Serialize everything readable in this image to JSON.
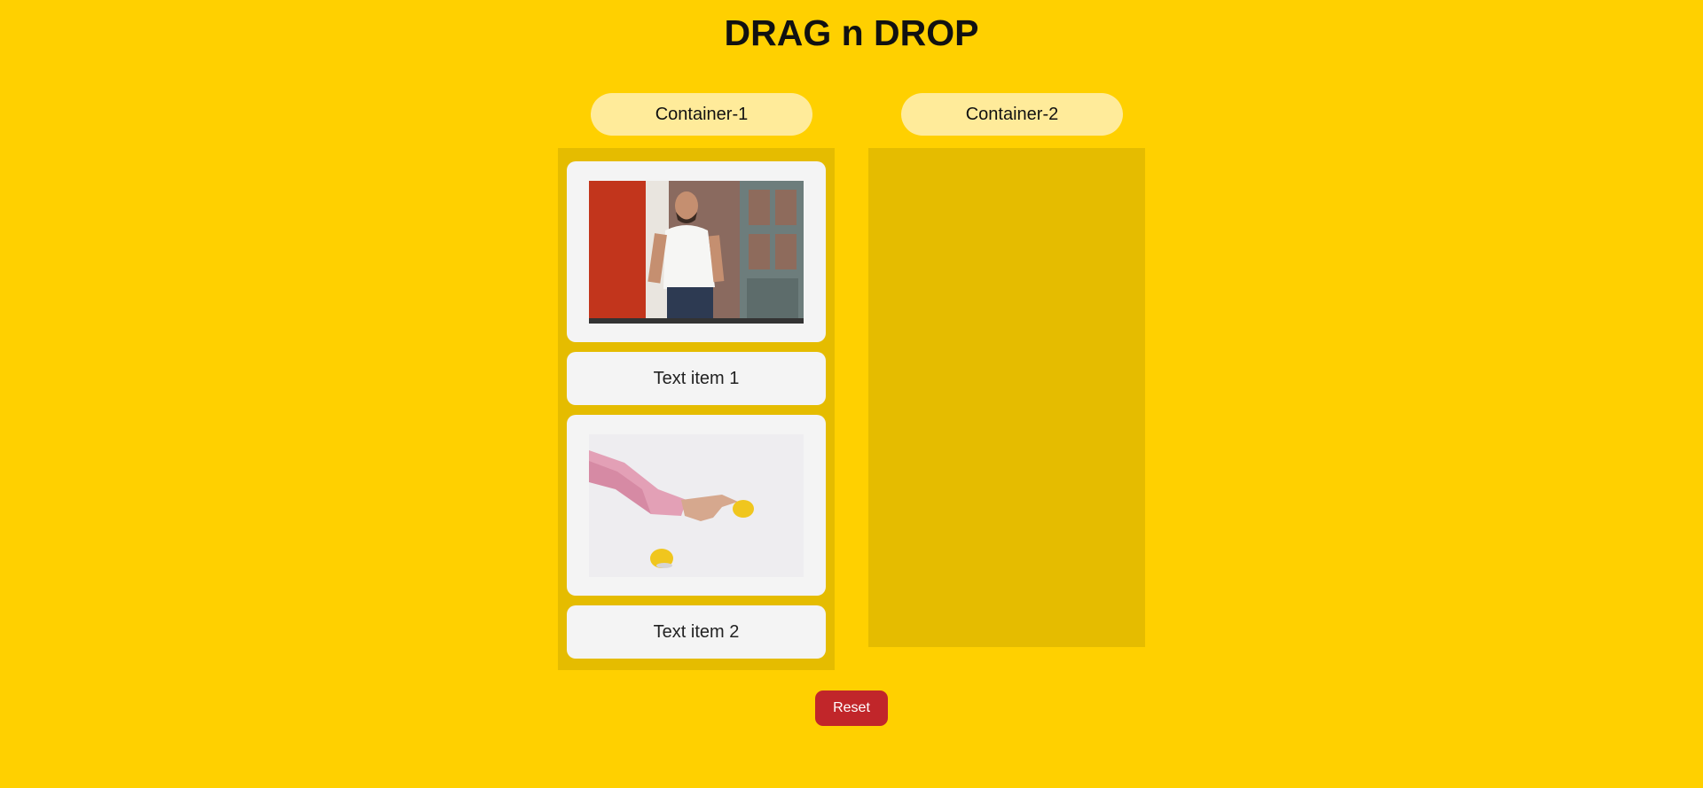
{
  "page": {
    "title": "DRAG n DROP"
  },
  "containers": [
    {
      "label": "Container-1"
    },
    {
      "label": "Container-2"
    }
  ],
  "items": [
    {
      "type": "image",
      "alt": "man-leaning-on-door-photo"
    },
    {
      "type": "text",
      "label": "Text item 1"
    },
    {
      "type": "image",
      "alt": "hand-with-lemons-photo"
    },
    {
      "type": "text",
      "label": "Text item 2"
    }
  ],
  "actions": {
    "reset_label": "Reset"
  },
  "colors": {
    "background": "#ffd000",
    "container": "#e5bc00",
    "pill": "#ffeb9a",
    "card": "#f4f4f4",
    "reset": "#c1262a"
  }
}
